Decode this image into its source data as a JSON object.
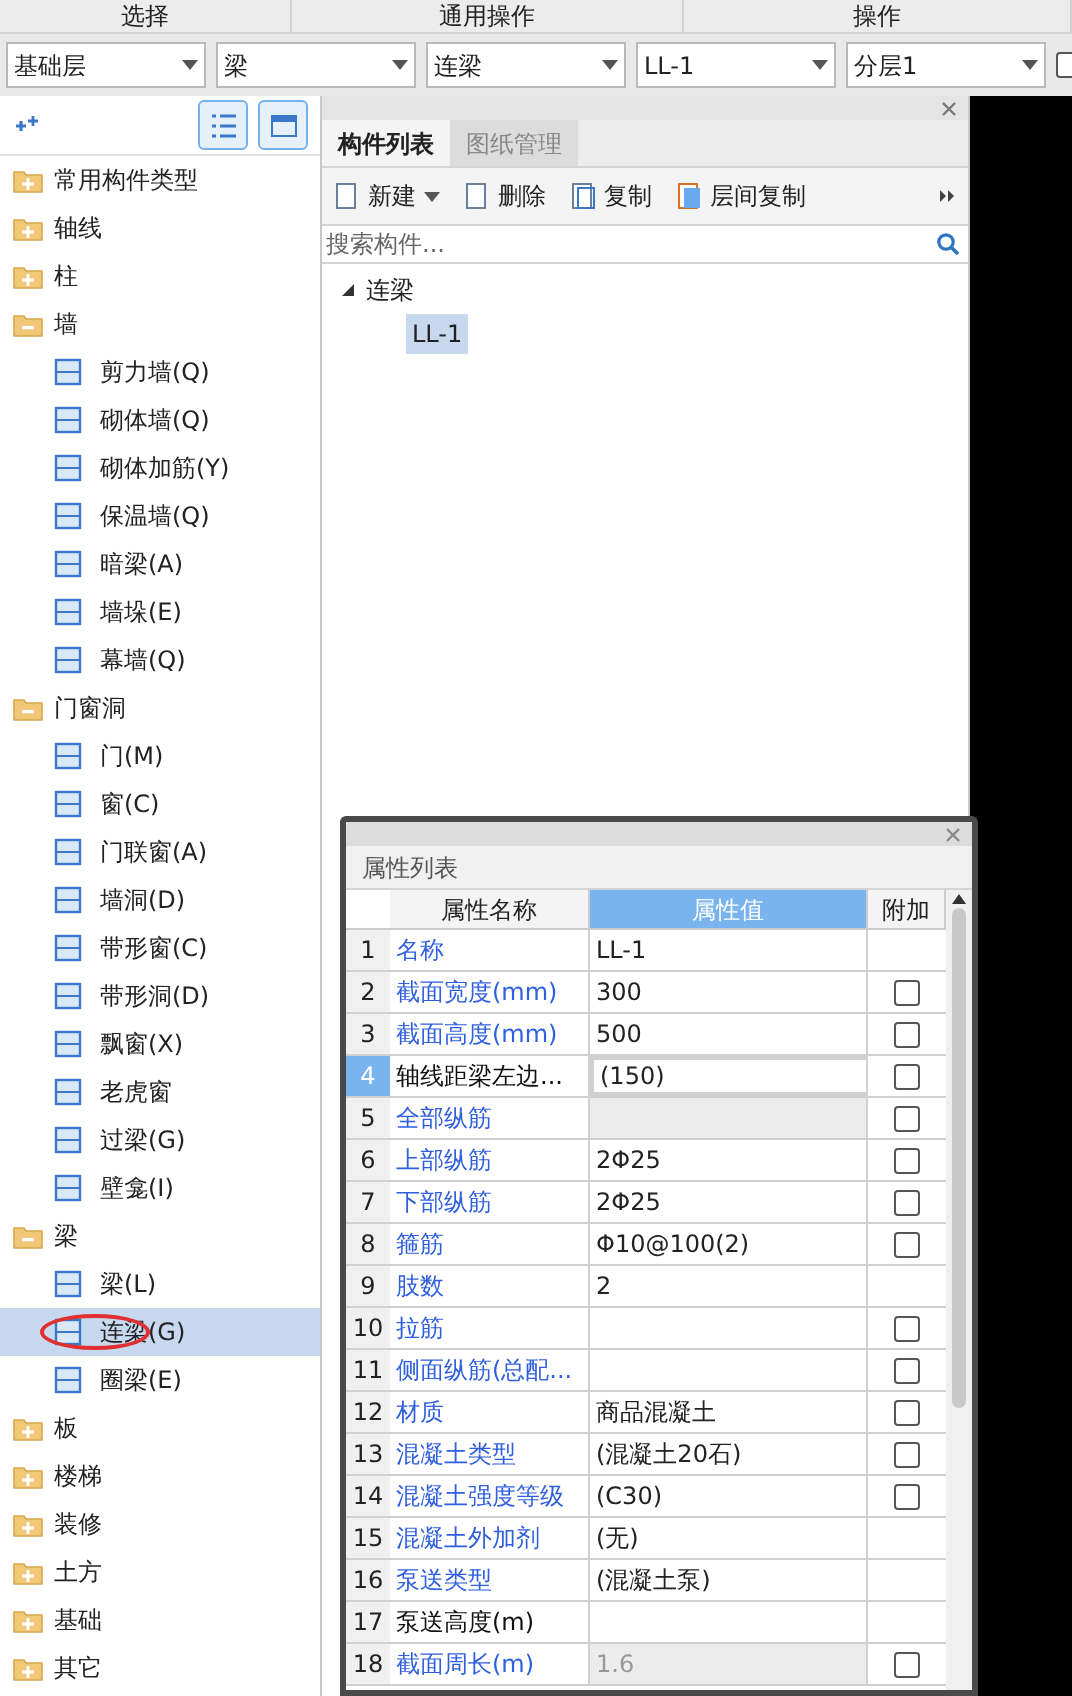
{
  "ribbon_groups": [
    "选择",
    "通用操作",
    "操作"
  ],
  "selectors": [
    "基础层",
    "梁",
    "连梁",
    "LL-1",
    "分层1"
  ],
  "selector_checkbox": {
    "checked": false
  },
  "tree": [
    {
      "label": "常用构件类型",
      "expanded": false
    },
    {
      "label": "轴线",
      "expanded": false
    },
    {
      "label": "柱",
      "expanded": false
    },
    {
      "label": "墙",
      "expanded": true,
      "children": [
        {
          "label": "剪力墙(Q)",
          "selected": false
        },
        {
          "label": "砌体墙(Q)",
          "selected": false
        },
        {
          "label": "砌体加筋(Y)",
          "selected": false
        },
        {
          "label": "保温墙(Q)",
          "selected": false
        },
        {
          "label": "暗梁(A)",
          "selected": false
        },
        {
          "label": "墙垛(E)",
          "selected": false
        },
        {
          "label": "幕墙(Q)",
          "selected": false
        }
      ]
    },
    {
      "label": "门窗洞",
      "expanded": true,
      "children": [
        {
          "label": "门(M)",
          "selected": false
        },
        {
          "label": "窗(C)",
          "selected": false
        },
        {
          "label": "门联窗(A)",
          "selected": false
        },
        {
          "label": "墙洞(D)",
          "selected": false
        },
        {
          "label": "带形窗(C)",
          "selected": false
        },
        {
          "label": "带形洞(D)",
          "selected": false
        },
        {
          "label": "飘窗(X)",
          "selected": false
        },
        {
          "label": "老虎窗",
          "selected": false
        },
        {
          "label": "过梁(G)",
          "selected": false
        },
        {
          "label": "壁龛(I)",
          "selected": false
        }
      ]
    },
    {
      "label": "梁",
      "expanded": true,
      "children": [
        {
          "label": "梁(L)",
          "selected": false
        },
        {
          "label": "连梁(G)",
          "selected": true,
          "circled": true
        },
        {
          "label": "圈梁(E)",
          "selected": false
        }
      ]
    },
    {
      "label": "板",
      "expanded": false
    },
    {
      "label": "楼梯",
      "expanded": false
    },
    {
      "label": "装修",
      "expanded": false
    },
    {
      "label": "土方",
      "expanded": false
    },
    {
      "label": "基础",
      "expanded": false
    },
    {
      "label": "其它",
      "expanded": false
    }
  ],
  "component_panel": {
    "tabs": [
      {
        "label": "构件列表",
        "selected": true
      },
      {
        "label": "图纸管理",
        "selected": false
      }
    ],
    "toolbar": [
      "新建",
      "删除",
      "复制",
      "层间复制"
    ],
    "search": {
      "placeholder": "搜索构件..."
    },
    "tree": [
      {
        "label": "连梁",
        "expanded": true,
        "children": [
          {
            "label": "LL-1",
            "selected": true
          }
        ]
      }
    ]
  },
  "properties": {
    "title": "属性列表",
    "columns": [
      "属性名称",
      "属性值",
      "附加"
    ],
    "rows": [
      {
        "num": "1",
        "name": "名称",
        "value": "LL-1",
        "linked": true,
        "selected": false
      },
      {
        "num": "2",
        "name": "截面宽度(mm)",
        "value": "300",
        "linked": true,
        "selected": false,
        "checkbox": false
      },
      {
        "num": "3",
        "name": "截面高度(mm)",
        "value": "500",
        "linked": true,
        "selected": false,
        "checkbox": false
      },
      {
        "num": "4",
        "name": "轴线距梁左边...",
        "value": "(150)",
        "linked": false,
        "selected": true,
        "checkbox": false
      },
      {
        "num": "5",
        "name": "全部纵筋",
        "linked": true,
        "selected": false,
        "disabled": true,
        "checkbox": false
      },
      {
        "num": "6",
        "name": "上部纵筋",
        "value": "2Φ25",
        "linked": true,
        "selected": false,
        "checkbox": false
      },
      {
        "num": "7",
        "name": "下部纵筋",
        "value": "2Φ25",
        "linked": true,
        "selected": false,
        "checkbox": false
      },
      {
        "num": "8",
        "name": "箍筋",
        "value": "Φ10@100(2)",
        "linked": true,
        "selected": false,
        "checkbox": false
      },
      {
        "num": "9",
        "name": "肢数",
        "value": "2",
        "linked": true,
        "selected": false
      },
      {
        "num": "10",
        "name": "拉筋",
        "linked": true,
        "selected": false,
        "checkbox": false
      },
      {
        "num": "11",
        "name": "侧面纵筋(总配...",
        "linked": true,
        "selected": false,
        "checkbox": false
      },
      {
        "num": "12",
        "name": "材质",
        "value": "商品混凝土",
        "linked": true,
        "selected": false,
        "checkbox": false
      },
      {
        "num": "13",
        "name": "混凝土类型",
        "value": "(混凝土20石)",
        "linked": true,
        "selected": false,
        "checkbox": false
      },
      {
        "num": "14",
        "name": "混凝土强度等级",
        "value": "(C30)",
        "linked": true,
        "selected": false,
        "checkbox": false
      },
      {
        "num": "15",
        "name": "混凝土外加剂",
        "value": "(无)",
        "linked": true,
        "selected": false
      },
      {
        "num": "16",
        "name": "泵送类型",
        "value": "(混凝土泵)",
        "linked": true,
        "selected": false
      },
      {
        "num": "17",
        "name": "泵送高度(m)",
        "linked": false,
        "selected": false
      },
      {
        "num": "18",
        "name": "截面周长(m)",
        "value": "1.6",
        "linked": true,
        "selected": false,
        "disabled": true,
        "checkbox": false
      }
    ]
  }
}
